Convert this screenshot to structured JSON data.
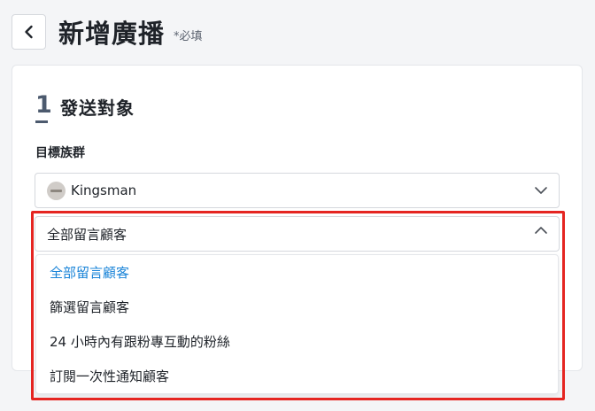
{
  "header": {
    "title": "新增廣播",
    "required_note": "*必填"
  },
  "step": {
    "number": "1",
    "title": "發送對象"
  },
  "target": {
    "label": "目標族群",
    "page_select": {
      "value": "Kingsman"
    },
    "audience_select": {
      "value": "全部留言顧客",
      "expanded": true,
      "options": [
        {
          "label": "全部留言顧客",
          "selected": true
        },
        {
          "label": "篩選留言顧客",
          "selected": false
        },
        {
          "label": "24 小時內有跟粉專互動的粉絲",
          "selected": false
        },
        {
          "label": "訂閱一次性通知顧客",
          "selected": false
        }
      ]
    }
  },
  "colors": {
    "accent": "#1a84d8",
    "highlight": "#e52521",
    "step": "#4c5a6e"
  }
}
